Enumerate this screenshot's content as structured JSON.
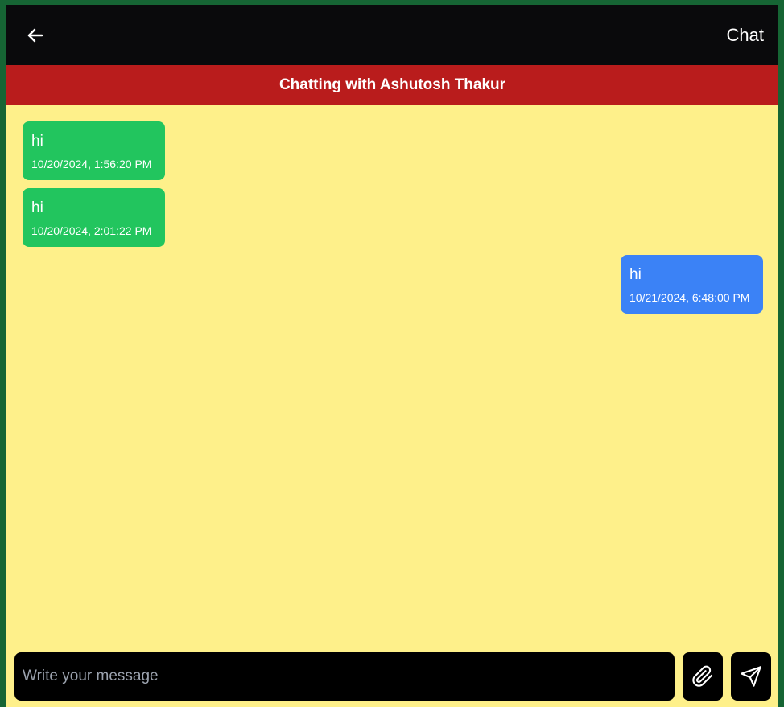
{
  "topbar": {
    "back_icon": "arrow-left-icon",
    "title": "Chat"
  },
  "chat_header": {
    "title": "Chatting with Ashutosh Thakur"
  },
  "messages": [
    {
      "direction": "received",
      "text": "hi",
      "timestamp": "10/20/2024, 1:56:20 PM"
    },
    {
      "direction": "received",
      "text": "hi",
      "timestamp": "10/20/2024, 2:01:22 PM"
    },
    {
      "direction": "sent",
      "text": "hi",
      "timestamp": "10/21/2024, 6:48:00 PM"
    }
  ],
  "composer": {
    "placeholder": "Write your message",
    "value": "",
    "attach_icon": "paperclip-icon",
    "send_icon": "send-icon"
  },
  "colors": {
    "outer_border": "#166534",
    "topbar_bg": "#0a0a0c",
    "header_bg": "#b91c1c",
    "chat_bg": "#fef08a",
    "received_bubble": "#22c55e",
    "sent_bubble": "#3b82f6",
    "composer_bg": "#000000"
  }
}
